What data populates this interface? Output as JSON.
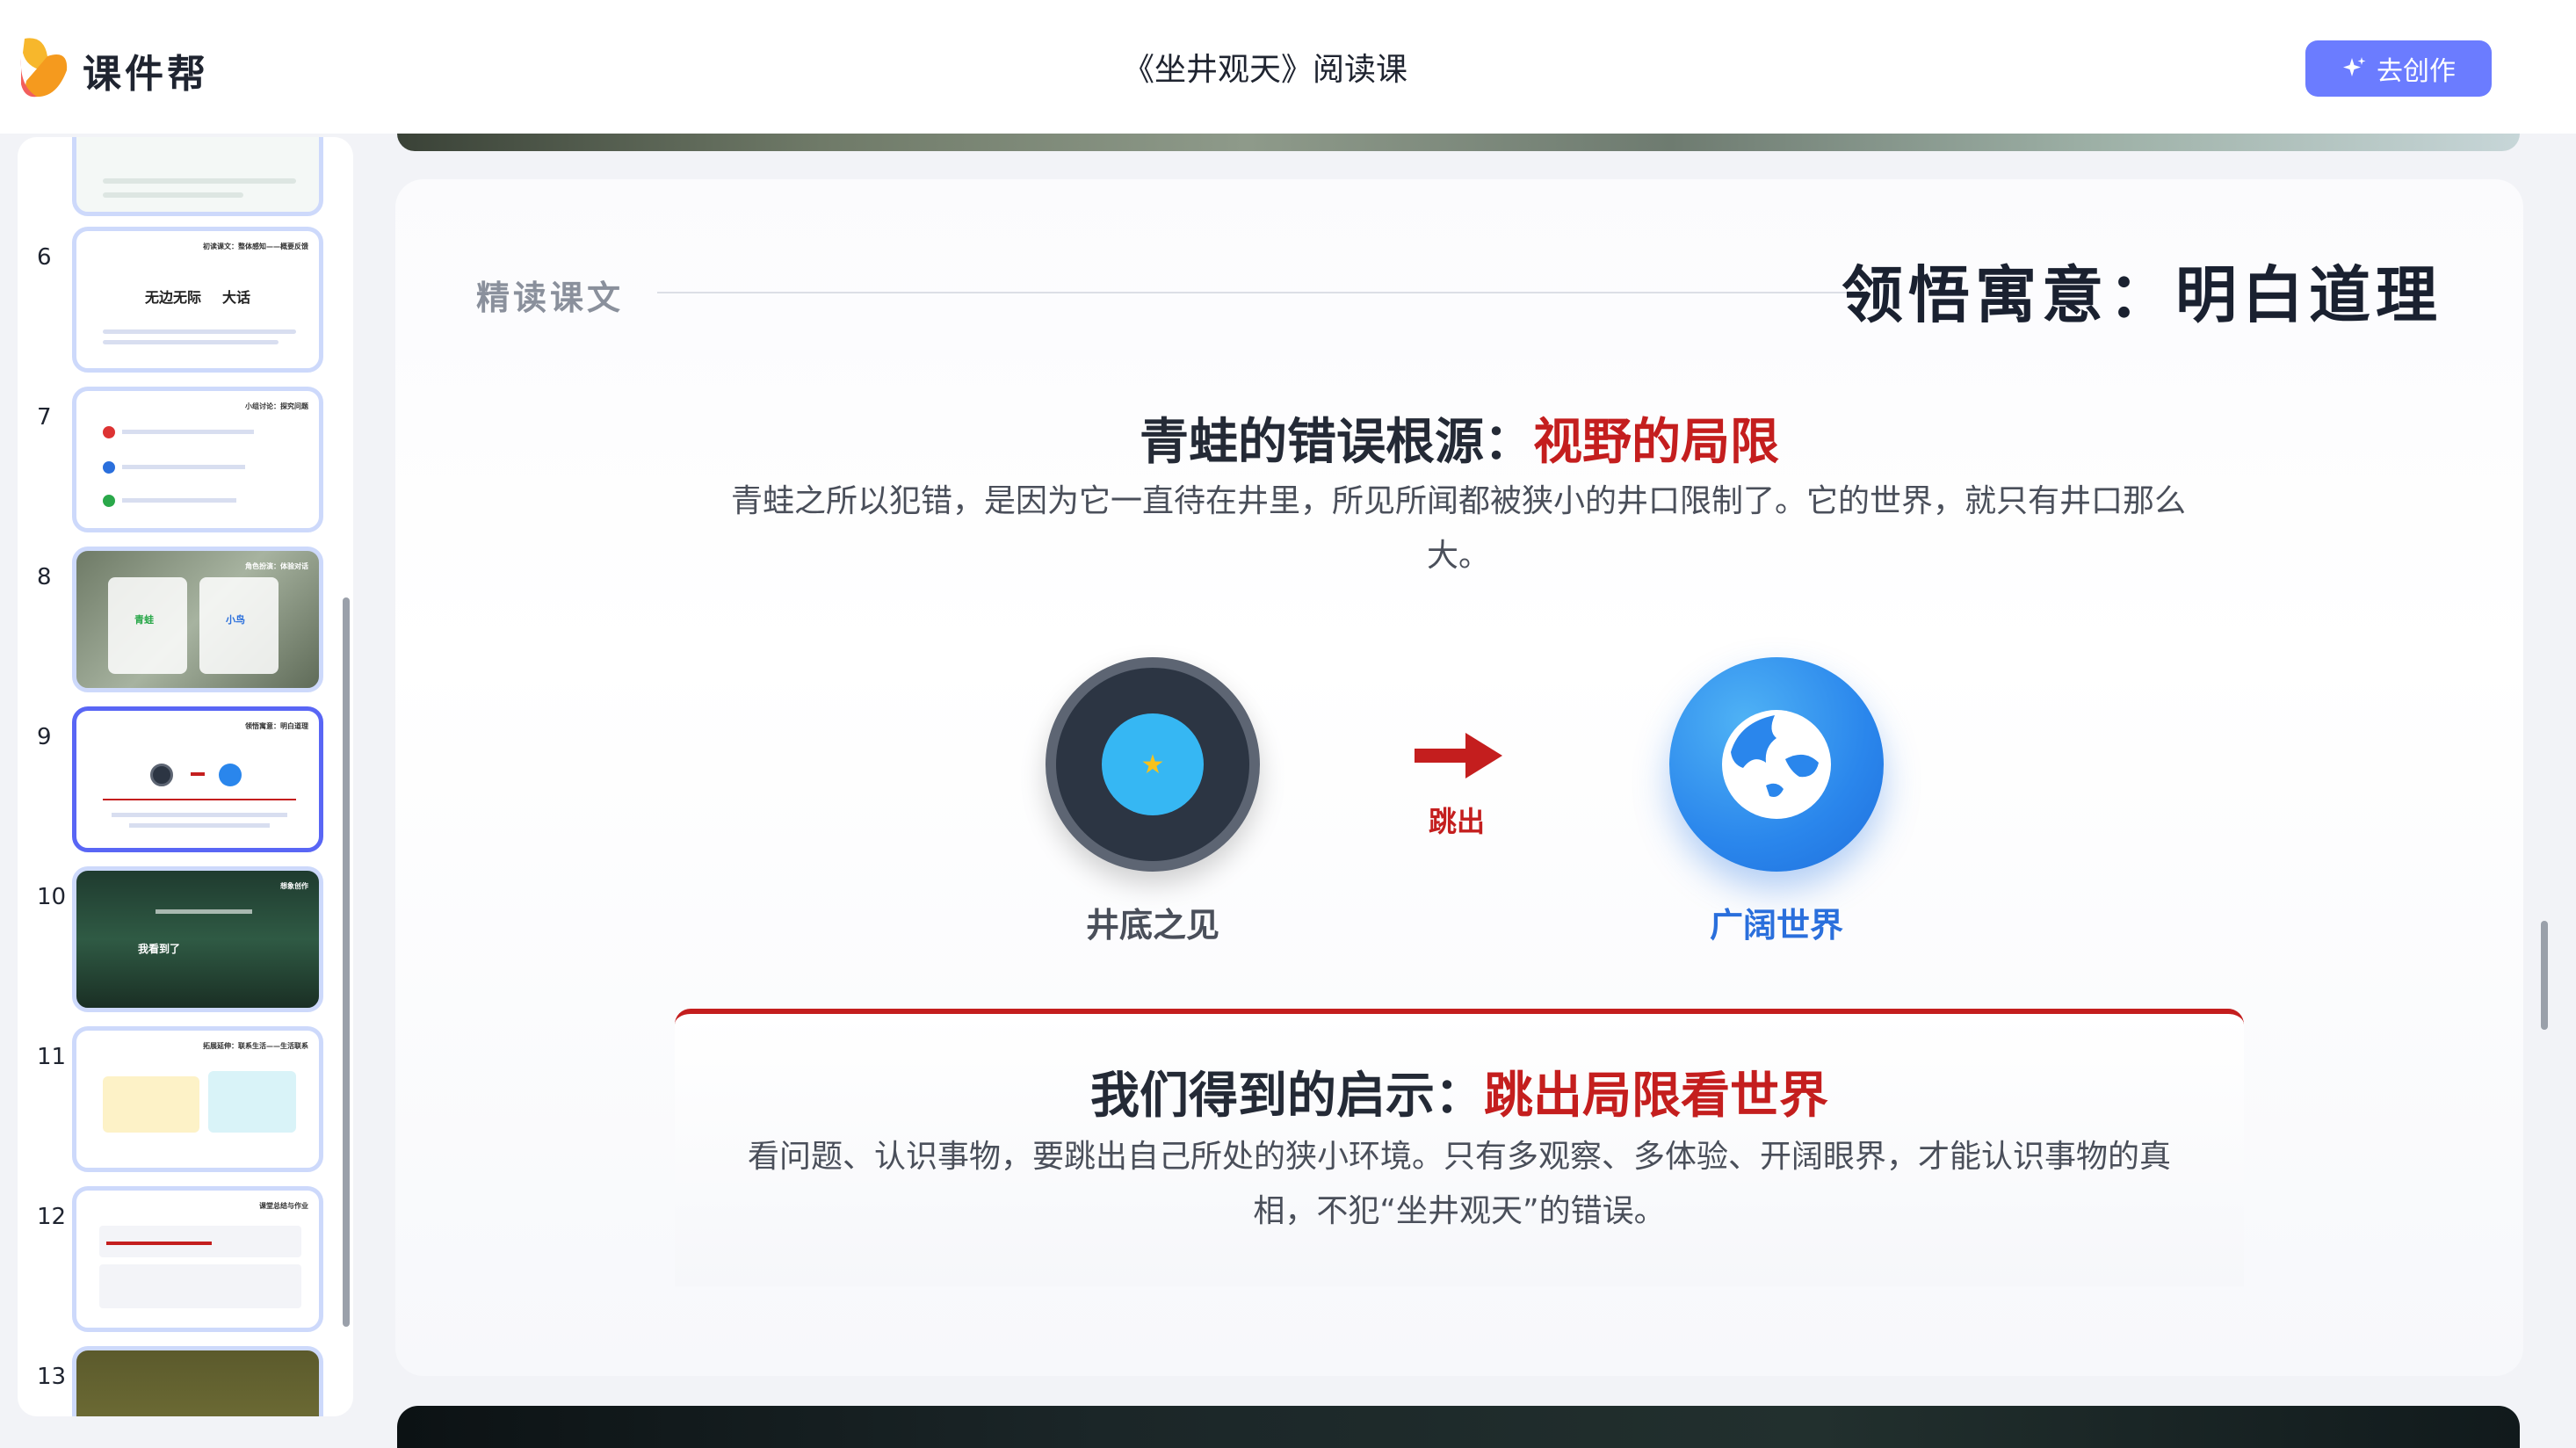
{
  "app": {
    "brand": "课件帮",
    "doc_title": "《坐井观天》阅读课",
    "create_button": "去创作"
  },
  "sidebar": {
    "thumbnails": [
      {
        "number": "",
        "title": ""
      },
      {
        "number": "6",
        "title": "初读课文：整体感知——概要反馈",
        "words": [
          "无边无际",
          "大话"
        ]
      },
      {
        "number": "7",
        "title": "小组讨论：探究问题"
      },
      {
        "number": "8",
        "title": "角色扮演：体验对话",
        "roles": [
          "青蛙",
          "小鸟"
        ]
      },
      {
        "number": "9",
        "title": "领悟寓意：明白道理"
      },
      {
        "number": "10",
        "title": "想象创作",
        "text": "我看到了"
      },
      {
        "number": "11",
        "title": "拓展延伸：联系生活——生活联系"
      },
      {
        "number": "12",
        "title": "课堂总结与作业"
      },
      {
        "number": "13",
        "title": ""
      }
    ]
  },
  "slide": {
    "section_label": "精读课文",
    "heading": "领悟寓意：明白道理",
    "subtitle1_prefix": "青蛙的错误根源：",
    "subtitle1_highlight": "视野的局限",
    "paragraph1": "青蛙之所以犯错，是因为它一直待在井里，所见所闻都被狭小的井口限制了。它的世界，就只有井口那么大。",
    "left_caption": "井底之见",
    "right_caption": "广阔世界",
    "arrow_label": "跳出",
    "subtitle2_prefix": "我们得到的启示：",
    "subtitle2_highlight": "跳出局限看世界",
    "paragraph2": "看问题、认识事物，要跳出自己所处的狭小环境。只有多观察、多体验、开阔眼界，才能认识事物的真相，不犯“坐井观天”的错误。"
  },
  "colors": {
    "accent": "#6b7cff",
    "highlight_red": "#c41e1e",
    "world_blue": "#2a86ec",
    "well_dark": "#2c3543"
  }
}
